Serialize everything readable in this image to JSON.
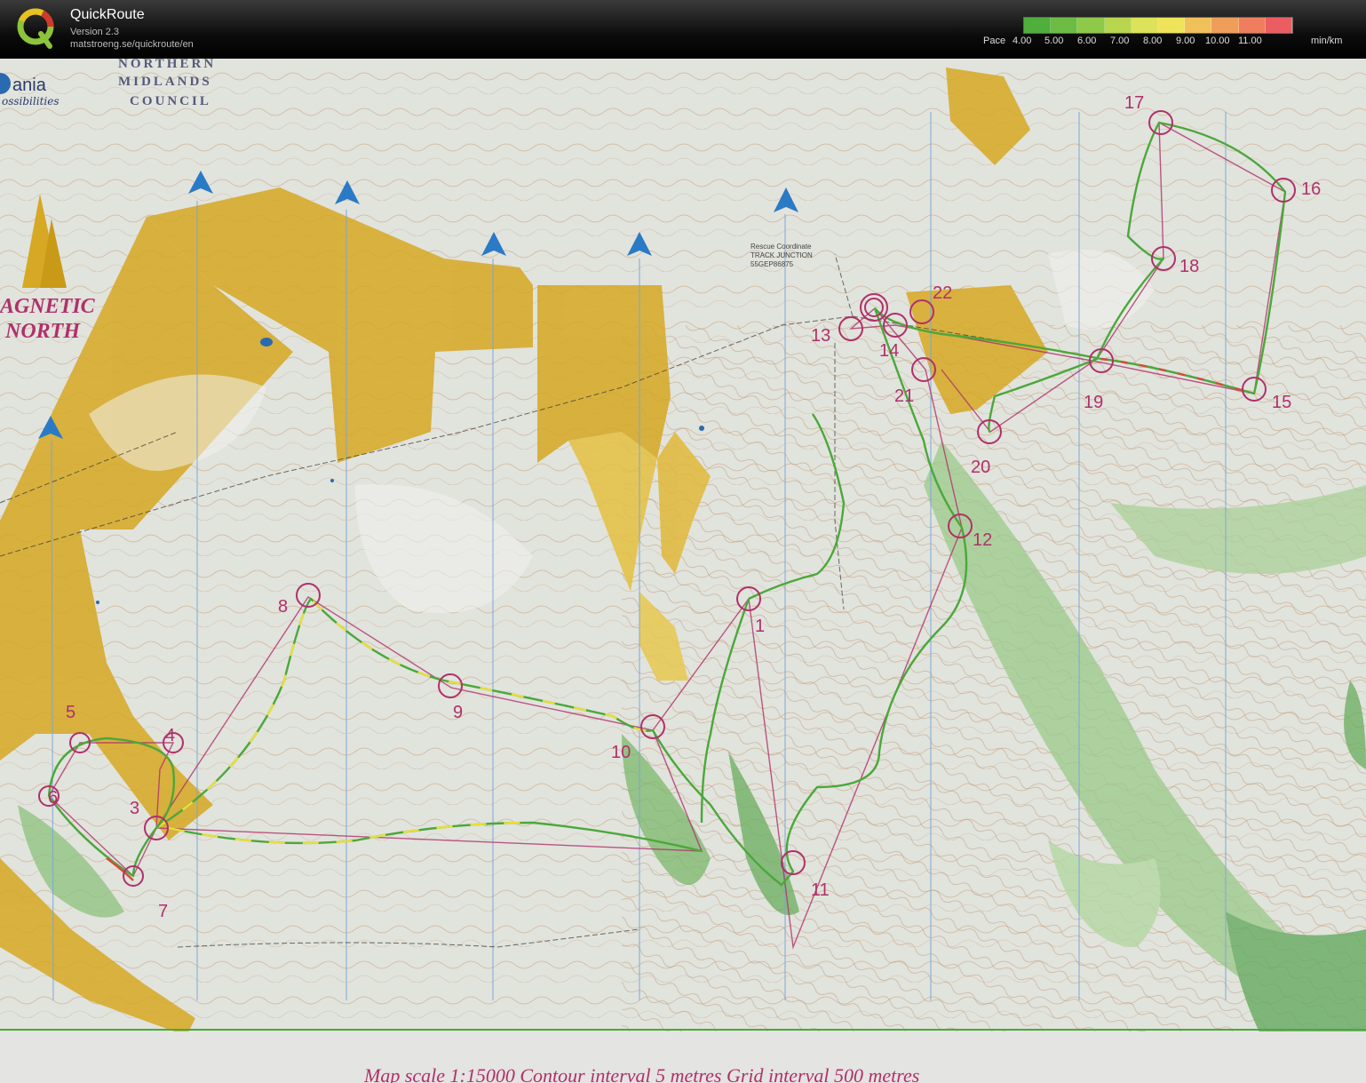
{
  "app": {
    "title": "QuickRoute",
    "version": "Version 2.3",
    "url": "matstroeng.se/quickroute/en"
  },
  "pace_legend": {
    "label": "Pace",
    "ticks": [
      "4.00",
      "5.00",
      "6.00",
      "7.00",
      "8.00",
      "9.00",
      "10.00",
      "11.00"
    ],
    "unit": "min/km",
    "colors": [
      "#4fae3c",
      "#6cbc44",
      "#8fc94a",
      "#b7d64e",
      "#dce25a",
      "#efe35a",
      "#f0c05a",
      "#ef9e5a",
      "#ee7e5e",
      "#ea5e62"
    ]
  },
  "map": {
    "council_lines": [
      "NORTHERN",
      "MIDLANDS",
      "COUNCIL"
    ],
    "sponsor_fragment": "ania",
    "sponsor_tagline": "ossibilities",
    "magnetic_north": [
      "AGNETIC",
      "NORTH"
    ],
    "rescue_note": [
      "Rescue Coordinate",
      "TRACK JUNCTION",
      "55GEP86875"
    ],
    "footer_note": "Map scale 1:15000  Contour interval 5 metres  Grid interval 500 metres",
    "controls": [
      {
        "label": "1"
      },
      {
        "label": "3"
      },
      {
        "label": "4"
      },
      {
        "label": "5"
      },
      {
        "label": "6"
      },
      {
        "label": "7"
      },
      {
        "label": "8"
      },
      {
        "label": "9"
      },
      {
        "label": "10"
      },
      {
        "label": "11"
      },
      {
        "label": "12"
      },
      {
        "label": "13"
      },
      {
        "label": "14"
      },
      {
        "label": "15"
      },
      {
        "label": "16"
      },
      {
        "label": "17"
      },
      {
        "label": "18"
      },
      {
        "label": "19"
      },
      {
        "label": "20"
      },
      {
        "label": "21"
      },
      {
        "label": "22"
      }
    ]
  }
}
